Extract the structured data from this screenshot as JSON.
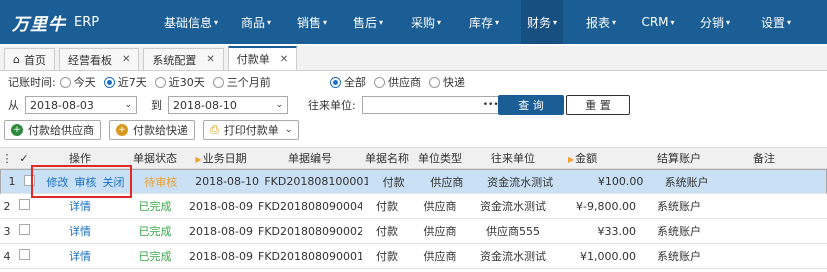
{
  "app": {
    "brand": "万里牛",
    "suffix": "ERP"
  },
  "nav": [
    {
      "label": "基础信息",
      "active": false
    },
    {
      "label": "商品",
      "active": false
    },
    {
      "label": "销售",
      "active": false
    },
    {
      "label": "售后",
      "active": false
    },
    {
      "label": "采购",
      "active": false
    },
    {
      "label": "库存",
      "active": false
    },
    {
      "label": "财务",
      "active": true
    },
    {
      "label": "报表",
      "active": false
    },
    {
      "label": "CRM",
      "active": false
    },
    {
      "label": "分销",
      "active": false
    },
    {
      "label": "设置",
      "active": false
    }
  ],
  "tabs": [
    {
      "label": "首页",
      "closable": false,
      "active": false
    },
    {
      "label": "经营看板",
      "closable": true,
      "active": false
    },
    {
      "label": "系统配置",
      "closable": true,
      "active": false
    },
    {
      "label": "付款单",
      "closable": true,
      "active": true
    }
  ],
  "filters": {
    "time_label": "记账时间:",
    "time_options": [
      "今天",
      "近7天",
      "近30天",
      "三个月前"
    ],
    "time_selected": "近7天",
    "type_options": [
      "全部",
      "供应商",
      "快递"
    ],
    "type_selected": "全部",
    "from_label": "从",
    "from_value": "2018-08-03",
    "to_label": "到",
    "to_value": "2018-08-10",
    "unit_label": "往来单位:",
    "unit_value": "",
    "unit_more": "•••",
    "query_label": "查 询",
    "reset_label": "重 置"
  },
  "actions": {
    "pay_supplier": "付款给供应商",
    "pay_express": "付款给快递",
    "print": "打印付款单"
  },
  "columns": {
    "op": "操作",
    "status": "单据状态",
    "date": "业务日期",
    "no": "单据编号",
    "name": "单据名称",
    "unit_type": "单位类型",
    "unit": "往来单位",
    "amount": "金额",
    "account": "结算账户",
    "remark": "备注"
  },
  "rows": [
    {
      "idx": "1",
      "ops": [
        "修改",
        "审核",
        "关闭"
      ],
      "status": "待审核",
      "status_type": "pending",
      "date": "2018-08-10",
      "no": "FKD201808100001",
      "name": "付款",
      "unit_type": "供应商",
      "unit": "资金流水测试",
      "amount": "¥100.00",
      "account": "系统账户",
      "remark": ""
    },
    {
      "idx": "2",
      "ops": [
        "详情"
      ],
      "status": "已完成",
      "status_type": "done",
      "date": "2018-08-09",
      "no": "FKD201808090004",
      "name": "付款",
      "unit_type": "供应商",
      "unit": "资金流水测试",
      "amount": "¥-9,800.00",
      "account": "系统账户",
      "remark": ""
    },
    {
      "idx": "3",
      "ops": [
        "详情"
      ],
      "status": "已完成",
      "status_type": "done",
      "date": "2018-08-09",
      "no": "FKD201808090002",
      "name": "付款",
      "unit_type": "供应商",
      "unit": "供应商555",
      "amount": "¥33.00",
      "account": "系统账户",
      "remark": ""
    },
    {
      "idx": "4",
      "ops": [
        "详情"
      ],
      "status": "已完成",
      "status_type": "done",
      "date": "2018-08-09",
      "no": "FKD201808090001",
      "name": "付款",
      "unit_type": "供应商",
      "unit": "资金流水测试",
      "amount": "¥1,000.00",
      "account": "系统账户",
      "remark": ""
    }
  ]
}
